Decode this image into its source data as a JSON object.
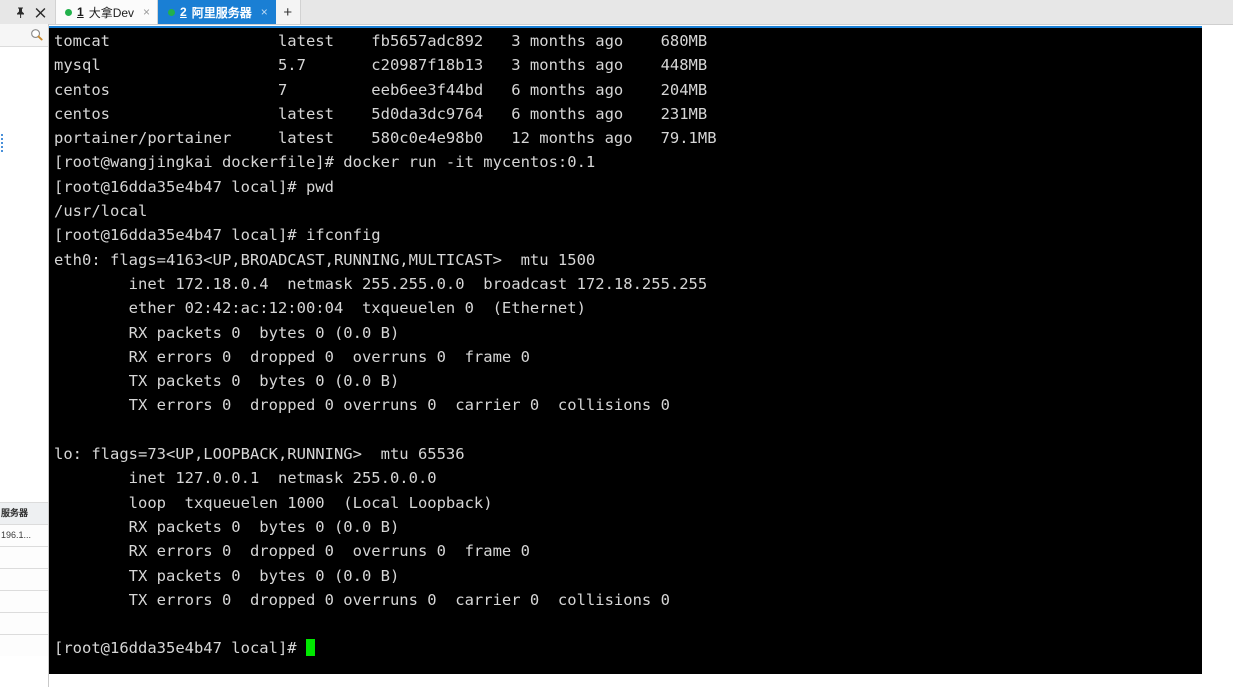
{
  "window": {
    "pin_icon": "pin-icon",
    "close_icon": "close-icon"
  },
  "tabs": [
    {
      "number": "1",
      "label": "大拿Dev",
      "close": "×",
      "active": false,
      "status_dot": "#22b14c"
    },
    {
      "number": "2",
      "label": "阿里服务器",
      "close": "×",
      "active": true,
      "status_dot": "#22b14c"
    }
  ],
  "new_tab_label": "+",
  "sidebar": {
    "search_icon": "search-icon",
    "rows": [
      {
        "text": "服务器",
        "header": true
      },
      {
        "text": "196.1...",
        "header": false
      },
      {
        "text": "",
        "header": false
      },
      {
        "text": "",
        "header": false
      },
      {
        "text": "",
        "header": false
      },
      {
        "text": "",
        "header": false
      },
      {
        "text": "",
        "header": false
      }
    ]
  },
  "terminal": {
    "accent_color": "#1a7fd4",
    "background": "#000000",
    "foreground": "#d6d6d6",
    "cursor_color": "#00e800",
    "cursor_glyph": "block-cursor",
    "lines": [
      "tomcat                  latest    fb5657adc892   3 months ago    680MB",
      "mysql                   5.7       c20987f18b13   3 months ago    448MB",
      "centos                  7         eeb6ee3f44bd   6 months ago    204MB",
      "centos                  latest    5d0da3dc9764   6 months ago    231MB",
      "portainer/portainer     latest    580c0e4e98b0   12 months ago   79.1MB",
      "[root@wangjingkai dockerfile]# docker run -it mycentos:0.1",
      "[root@16dda35e4b47 local]# pwd",
      "/usr/local",
      "[root@16dda35e4b47 local]# ifconfig",
      "eth0: flags=4163<UP,BROADCAST,RUNNING,MULTICAST>  mtu 1500",
      "        inet 172.18.0.4  netmask 255.255.0.0  broadcast 172.18.255.255",
      "        ether 02:42:ac:12:00:04  txqueuelen 0  (Ethernet)",
      "        RX packets 0  bytes 0 (0.0 B)",
      "        RX errors 0  dropped 0  overruns 0  frame 0",
      "        TX packets 0  bytes 0 (0.0 B)",
      "        TX errors 0  dropped 0 overruns 0  carrier 0  collisions 0",
      "",
      "lo: flags=73<UP,LOOPBACK,RUNNING>  mtu 65536",
      "        inet 127.0.0.1  netmask 255.0.0.0",
      "        loop  txqueuelen 1000  (Local Loopback)",
      "        RX packets 0  bytes 0 (0.0 B)",
      "        RX errors 0  dropped 0  overruns 0  frame 0",
      "        TX packets 0  bytes 0 (0.0 B)",
      "        TX errors 0  dropped 0 overruns 0  carrier 0  collisions 0",
      ""
    ],
    "prompt_line": "[root@16dda35e4b47 local]# "
  }
}
